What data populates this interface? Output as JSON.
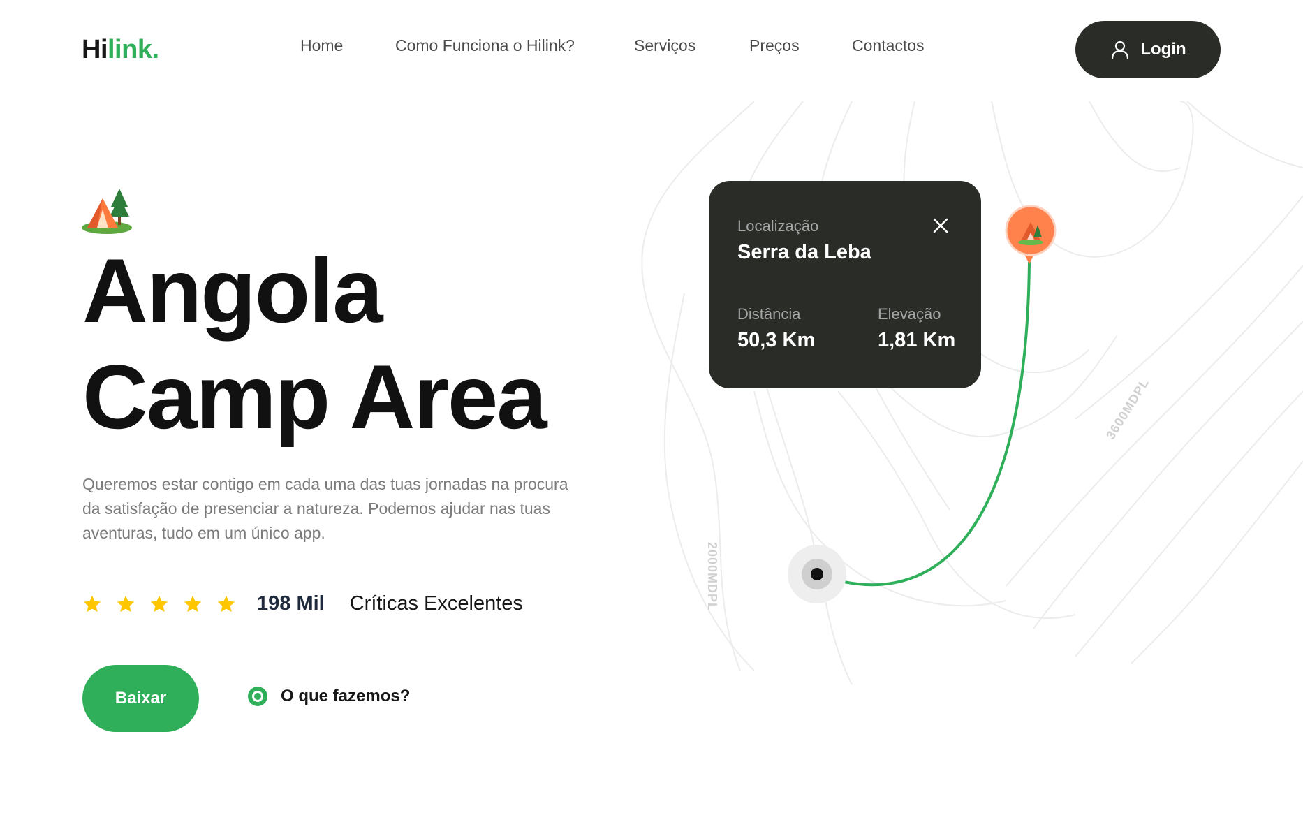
{
  "header": {
    "logo": {
      "part1": "Hi",
      "part2": "link",
      "part3": "."
    },
    "nav": [
      {
        "label": "Home"
      },
      {
        "label": "Como Funciona o Hilink?"
      },
      {
        "label": "Serviços"
      },
      {
        "label": "Preços"
      },
      {
        "label": "Contactos"
      }
    ],
    "login_label": "Login"
  },
  "hero": {
    "icon": "camping-tent-icon",
    "title_line1": "Angola",
    "title_line2": "Camp Area",
    "description": "Queremos estar contigo em cada uma das tuas jornadas na procura da satisfação de presenciar a natureza. Podemos ajudar nas tuas aventuras, tudo em um único app.",
    "rating": {
      "stars": 5,
      "count": "198 Mil",
      "label": "Críticas Excelentes"
    },
    "download_label": "Baixar",
    "play_label": "O que fazemos?"
  },
  "location_card": {
    "location_label": "Localização",
    "location_name": "Serra da Leba",
    "distance_label": "Distância",
    "distance_value": "50,3 Km",
    "elevation_label": "Elevação",
    "elevation_value": "1,81 Km"
  },
  "map": {
    "contour_labels": [
      "2000MDPL",
      "3600MDPL"
    ]
  },
  "colors": {
    "brand_green": "#30af5b",
    "dark": "#292c27",
    "star": "#fec601",
    "pin_orange": "#ff814c"
  }
}
